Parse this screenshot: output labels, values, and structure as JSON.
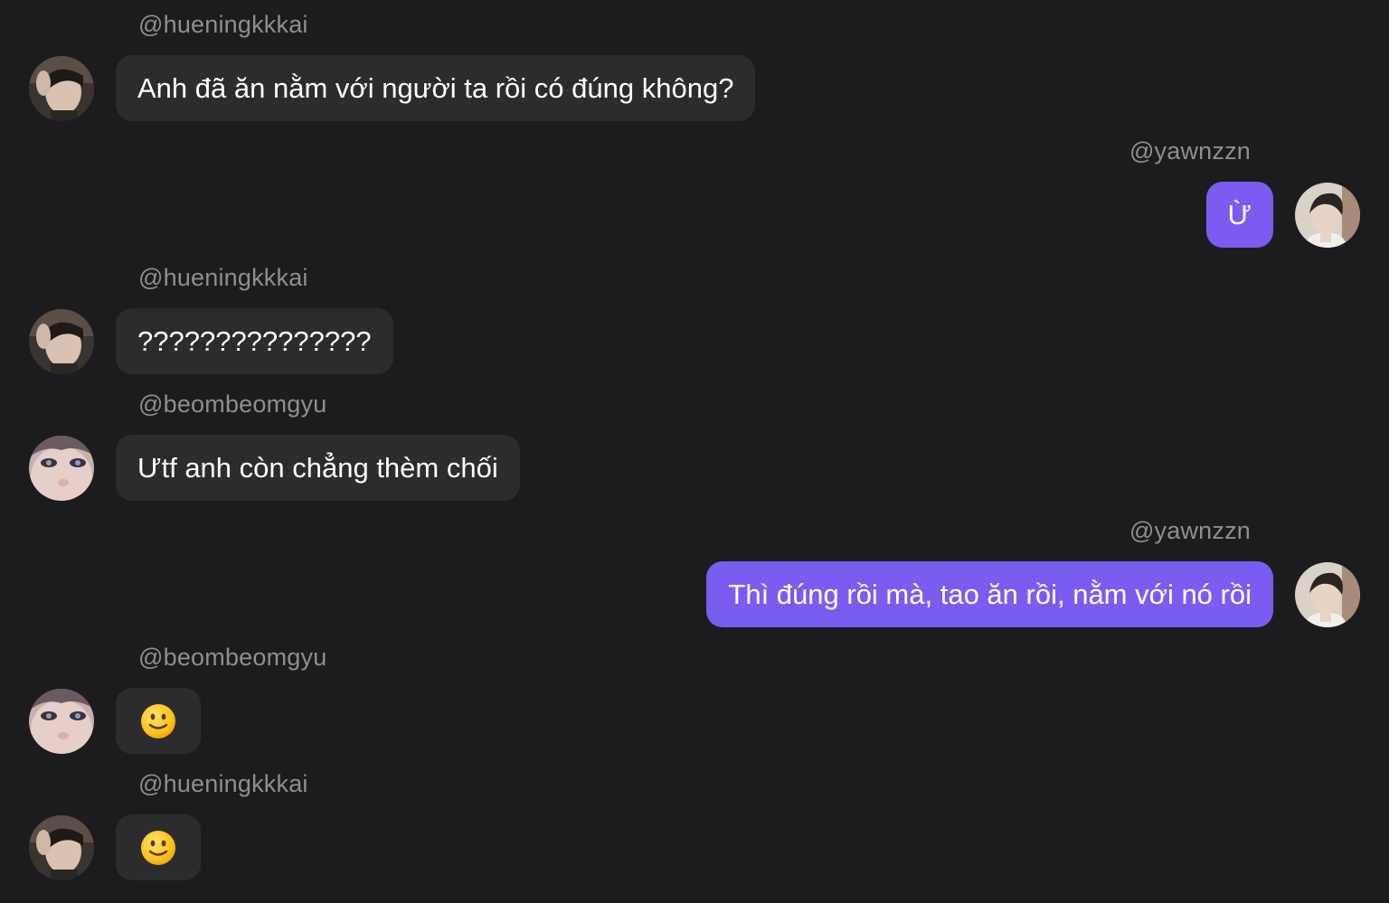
{
  "messages": [
    {
      "side": "in",
      "username": "@hueningkkkai",
      "avatar": "avatar-hueningkai-icon",
      "text": "Anh đã ăn nằm với người ta rồi có đúng không?"
    },
    {
      "side": "out",
      "username": "@yawnzzn",
      "avatar": "avatar-yawnzzn-icon",
      "text": "Ừ"
    },
    {
      "side": "in",
      "username": "@hueningkkkai",
      "avatar": "avatar-hueningkai-icon",
      "text": "???????????????"
    },
    {
      "side": "in",
      "username": "@beombeomgyu",
      "avatar": "avatar-beomgyu-icon",
      "text": "Ưtf anh còn chẳng thèm chối"
    },
    {
      "side": "out",
      "username": "@yawnzzn",
      "avatar": "avatar-yawnzzn-icon",
      "text": "Thì đúng rồi mà, tao ăn rồi, nằm với nó rồi"
    },
    {
      "side": "in",
      "username": "@beombeomgyu",
      "avatar": "avatar-beomgyu-icon",
      "emoji": "slightly-smiling-face-icon"
    },
    {
      "side": "in",
      "username": "@hueningkkkai",
      "avatar": "avatar-hueningkai-icon",
      "emoji": "slightly-smiling-face-icon"
    }
  ],
  "colors": {
    "background": "#1c1c1e",
    "incoming_bubble": "#2c2c2e",
    "outgoing_bubble": "#7a5cf0",
    "username": "#8e8e93",
    "text": "#ffffff"
  }
}
